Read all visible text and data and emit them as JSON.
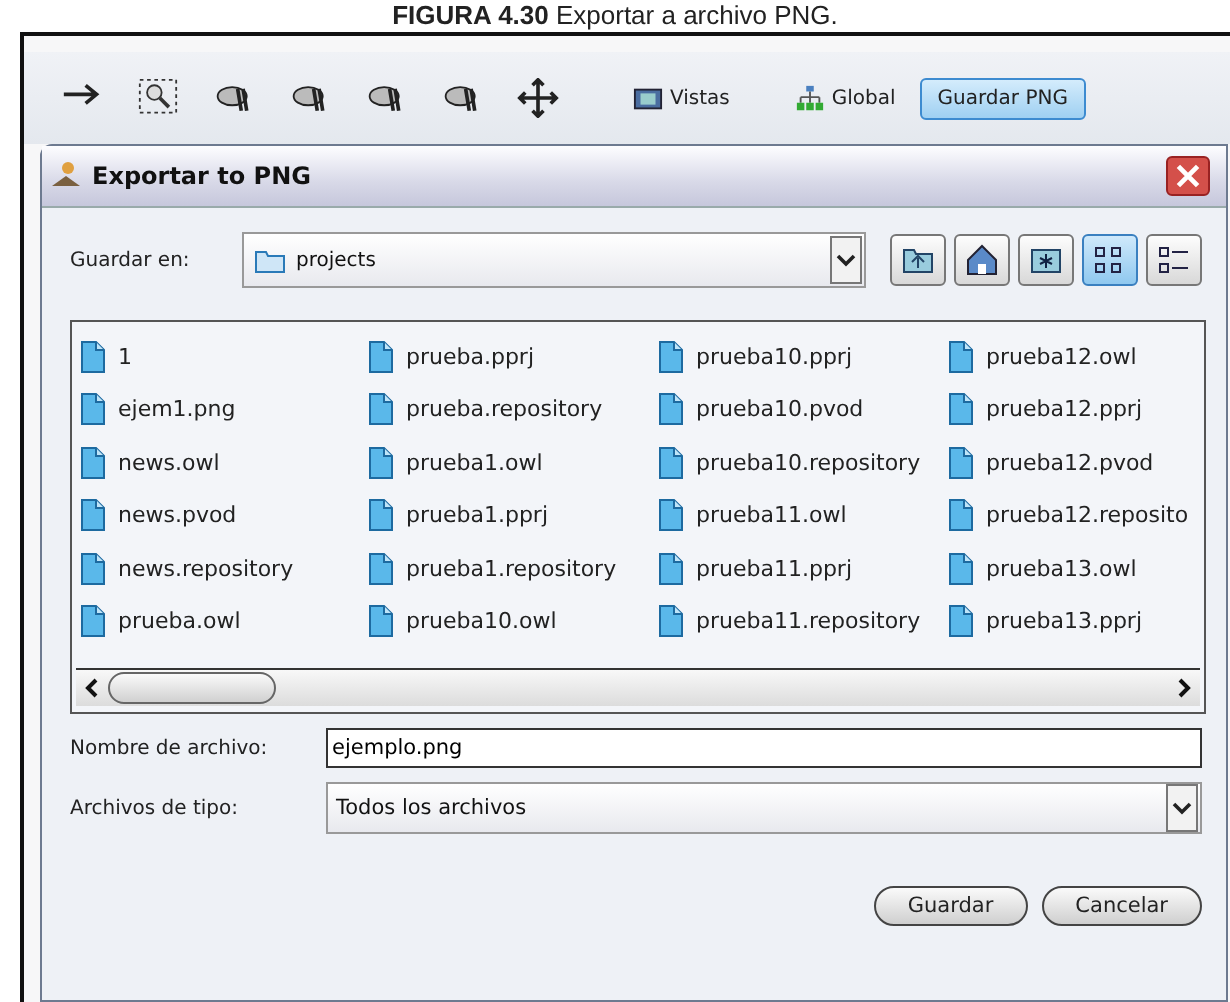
{
  "caption": {
    "number": "FIGURA 4.30",
    "text": "Exportar a archivo PNG."
  },
  "toolbar": {
    "tools": [
      {
        "kind": "arrow"
      },
      {
        "kind": "zoom"
      },
      {
        "kind": "tool"
      },
      {
        "kind": "tool"
      },
      {
        "kind": "tool"
      },
      {
        "kind": "tool"
      },
      {
        "kind": "move"
      }
    ],
    "buttons": [
      {
        "kind": "views",
        "label": "Vistas",
        "selected": false
      },
      {
        "kind": "global",
        "label": "Global",
        "selected": false
      },
      {
        "kind": "plain",
        "label": "Guardar PNG",
        "selected": true
      }
    ]
  },
  "dialog": {
    "title": "Exportar to PNG",
    "look_in": {
      "label": "Guardar en:",
      "value": "projects"
    },
    "nav_buttons": [
      {
        "kind": "up",
        "selected": false
      },
      {
        "kind": "home",
        "selected": false
      },
      {
        "kind": "newfolder",
        "selected": false
      },
      {
        "kind": "list",
        "selected": true
      },
      {
        "kind": "details",
        "selected": false
      }
    ],
    "files": [
      "1",
      "ejem1.png",
      "news.owl",
      "news.pvod",
      "news.repository",
      "prueba.owl",
      "prueba.pprj",
      "prueba.repository",
      "prueba1.owl",
      "prueba1.pprj",
      "prueba1.repository",
      "prueba10.owl",
      "prueba10.pprj",
      "prueba10.pvod",
      "prueba10.repository",
      "prueba11.owl",
      "prueba11.pprj",
      "prueba11.repository",
      "prueba12.owl",
      "prueba12.pprj",
      "prueba12.pvod",
      "prueba12.reposito",
      "prueba13.owl",
      "prueba13.pprj"
    ],
    "file_name": {
      "label": "Nombre de archivo:",
      "value": "ejemplo.png"
    },
    "file_type": {
      "label": "Archivos de tipo:",
      "value": "Todos los archivos"
    },
    "buttons": [
      "Guardar",
      "Cancelar"
    ]
  }
}
